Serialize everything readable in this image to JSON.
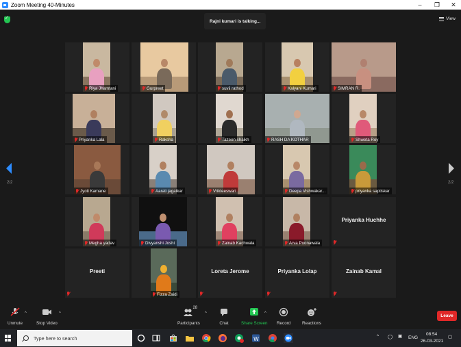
{
  "window": {
    "title": "Zoom Meeting 40-Minutes"
  },
  "meeting": {
    "speaker_banner": "Rajni kumari is talking...",
    "view_label": "View",
    "page_left": "2/2",
    "page_right": "2/2"
  },
  "participants": [
    {
      "name": "Riya Jhamtani",
      "video": true
    },
    {
      "name": "Gurpreet",
      "video": true
    },
    {
      "name": "suvii rathod",
      "video": true
    },
    {
      "name": "Kalyani Kumari",
      "video": true
    },
    {
      "name": "SIMRAN R.",
      "video": true
    },
    {
      "name": "Priyanka Lala",
      "video": true
    },
    {
      "name": "Raksha",
      "video": true
    },
    {
      "name": "Tazeen shaikh",
      "video": true
    },
    {
      "name": "RASH DA KOTHAR",
      "video": true
    },
    {
      "name": "Shweta Roy",
      "video": true
    },
    {
      "name": "Jyoti Kamane",
      "video": true
    },
    {
      "name": "Aarati jagatkar",
      "video": true
    },
    {
      "name": "Vrikteeswari",
      "video": true
    },
    {
      "name": "Deepa Vishwakar...",
      "video": true
    },
    {
      "name": "priyanka saptiskar",
      "video": true
    },
    {
      "name": "Megha yadav",
      "video": true
    },
    {
      "name": "Divyanshi Joshi",
      "video": true
    },
    {
      "name": "Zainab Kachwala",
      "video": true
    },
    {
      "name": "Arva Poonawala",
      "video": true
    },
    {
      "name": "Priyanka Huchhe",
      "video": false
    },
    {
      "name": "Preeti",
      "video": false
    },
    {
      "name": "Fizza Zaidi",
      "video": true
    },
    {
      "name": "Loreta Jerome",
      "video": false
    },
    {
      "name": "Priyanka Lolap",
      "video": false
    },
    {
      "name": "Zainab Kamal",
      "video": false
    }
  ],
  "toolbar": {
    "unmute": "Unmute",
    "stop_video": "Stop Video",
    "participants": "Participants",
    "participants_count": "28",
    "chat": "Chat",
    "share_screen": "Share Screen",
    "record": "Record",
    "reactions": "Reactions",
    "leave": "Leave"
  },
  "taskbar": {
    "search_placeholder": "Type here to search",
    "lang": "ENG",
    "time": "08:54",
    "date": "26-03-2021"
  },
  "colors": {
    "accent": "#2d8cff",
    "share_green": "#23c552",
    "leave_red": "#e02828",
    "mute_red": "#e02828"
  }
}
